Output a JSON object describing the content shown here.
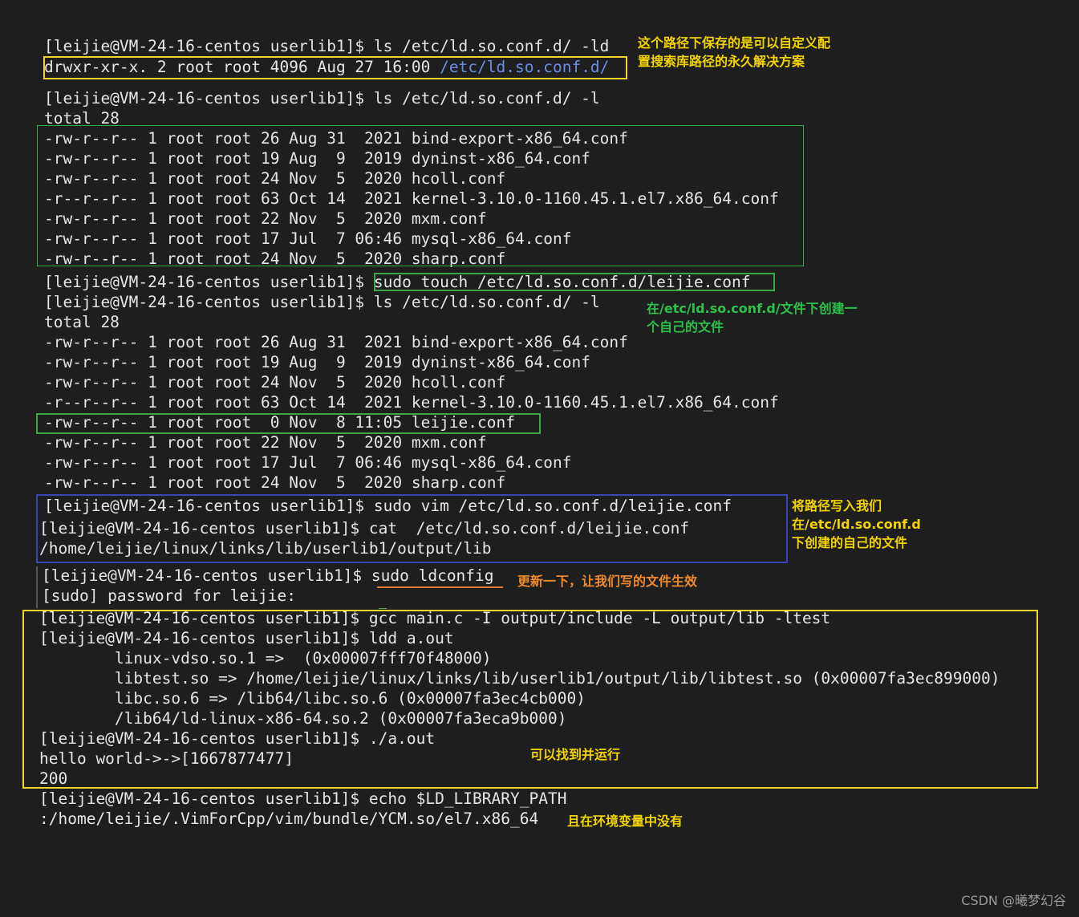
{
  "terminal": {
    "lines": [
      "[leijie@VM-24-16-centos userlib1]$ ls /etc/ld.so.conf.d/ -ld",
      "drwxr-xr-x. 2 root root 4096 Aug 27 16:00 ",
      "[leijie@VM-24-16-centos userlib1]$ ls /etc/ld.so.conf.d/ -l",
      "total 28",
      "-rw-r--r-- 1 root root 26 Aug 31  2021 bind-export-x86_64.conf",
      "-rw-r--r-- 1 root root 19 Aug  9  2019 dyninst-x86_64.conf",
      "-rw-r--r-- 1 root root 24 Nov  5  2020 hcoll.conf",
      "-r--r--r-- 1 root root 63 Oct 14  2021 kernel-3.10.0-1160.45.1.el7.x86_64.conf",
      "-rw-r--r-- 1 root root 22 Nov  5  2020 mxm.conf",
      "-rw-r--r-- 1 root root 17 Jul  7 06:46 mysql-x86_64.conf",
      "-rw-r--r-- 1 root root 24 Nov  5  2020 sharp.conf",
      "[leijie@VM-24-16-centos userlib1]$ sudo touch /etc/ld.so.conf.d/leijie.conf",
      "[leijie@VM-24-16-centos userlib1]$ ls /etc/ld.so.conf.d/ -l",
      "total 28",
      "-rw-r--r-- 1 root root 26 Aug 31  2021 bind-export-x86_64.conf",
      "-rw-r--r-- 1 root root 19 Aug  9  2019 dyninst-x86_64.conf",
      "-rw-r--r-- 1 root root 24 Nov  5  2020 hcoll.conf",
      "-r--r--r-- 1 root root 63 Oct 14  2021 kernel-3.10.0-1160.45.1.el7.x86_64.conf",
      "-rw-r--r-- 1 root root  0 Nov  8 11:05 leijie.conf",
      "-rw-r--r-- 1 root root 22 Nov  5  2020 mxm.conf",
      "-rw-r--r-- 1 root root 17 Jul  7 06:46 mysql-x86_64.conf",
      "-rw-r--r-- 1 root root 24 Nov  5  2020 sharp.conf",
      "[leijie@VM-24-16-centos userlib1]$ sudo vim /etc/ld.so.conf.d/leijie.conf",
      "[leijie@VM-24-16-centos userlib1]$ cat  /etc/ld.so.conf.d/leijie.conf",
      "/home/leijie/linux/links/lib/userlib1/output/lib",
      "[leijie@VM-24-16-centos userlib1]$ sudo ldconfig",
      "[sudo] password for leijie:",
      "[leijie@VM-24-16-centos userlib1]$ gcc main.c -I output/include -L output/lib -ltest",
      "[leijie@VM-24-16-centos userlib1]$ ldd a.out",
      "        linux-vdso.so.1 =>  (0x00007fff70f48000)",
      "        libtest.so => /home/leijie/linux/links/lib/userlib1/output/lib/libtest.so (0x00007fa3ec899000)",
      "        libc.so.6 => /lib64/libc.so.6 (0x00007fa3ec4cb000)",
      "        /lib64/ld-linux-x86-64.so.2 (0x00007fa3eca9b000)",
      "[leijie@VM-24-16-centos userlib1]$ ./a.out",
      "hello world->->[1667877477]",
      "200",
      "[leijie@VM-24-16-centos userlib1]$ echo $LD_LIBRARY_PATH",
      ":/home/leijie/.VimForCpp/vim/bundle/YCM.so/el7.x86_64"
    ],
    "highlight_dir": "/etc/ld.so.conf.d/"
  },
  "annotations": [
    "这个路径下保存的是可以自定义配\n置搜索库路径的永久解决方案",
    "在/etc/ld.so.conf.d/文件下创建一\n个自己的文件",
    "将路径写入我们\n在/etc/ld.so.conf.d\n下创建的自己的文件",
    "更新一下，让我们写的文件生效",
    "可以找到并运行",
    "且在环境变量中没有"
  ],
  "watermark": "CSDN @曦梦幻谷",
  "colors": {
    "background": "#1e1e1e",
    "text": "#e6e6e6",
    "dir_highlight": "#6b8fe8",
    "box_yellow": "#f0d430",
    "box_green": "#3aa84a",
    "box_blue": "#3b45b8",
    "underline_orange": "#e27b2f",
    "note_yellow": "#f2d400",
    "note_green": "#2cc24a",
    "note_orange": "#f08a2a"
  }
}
